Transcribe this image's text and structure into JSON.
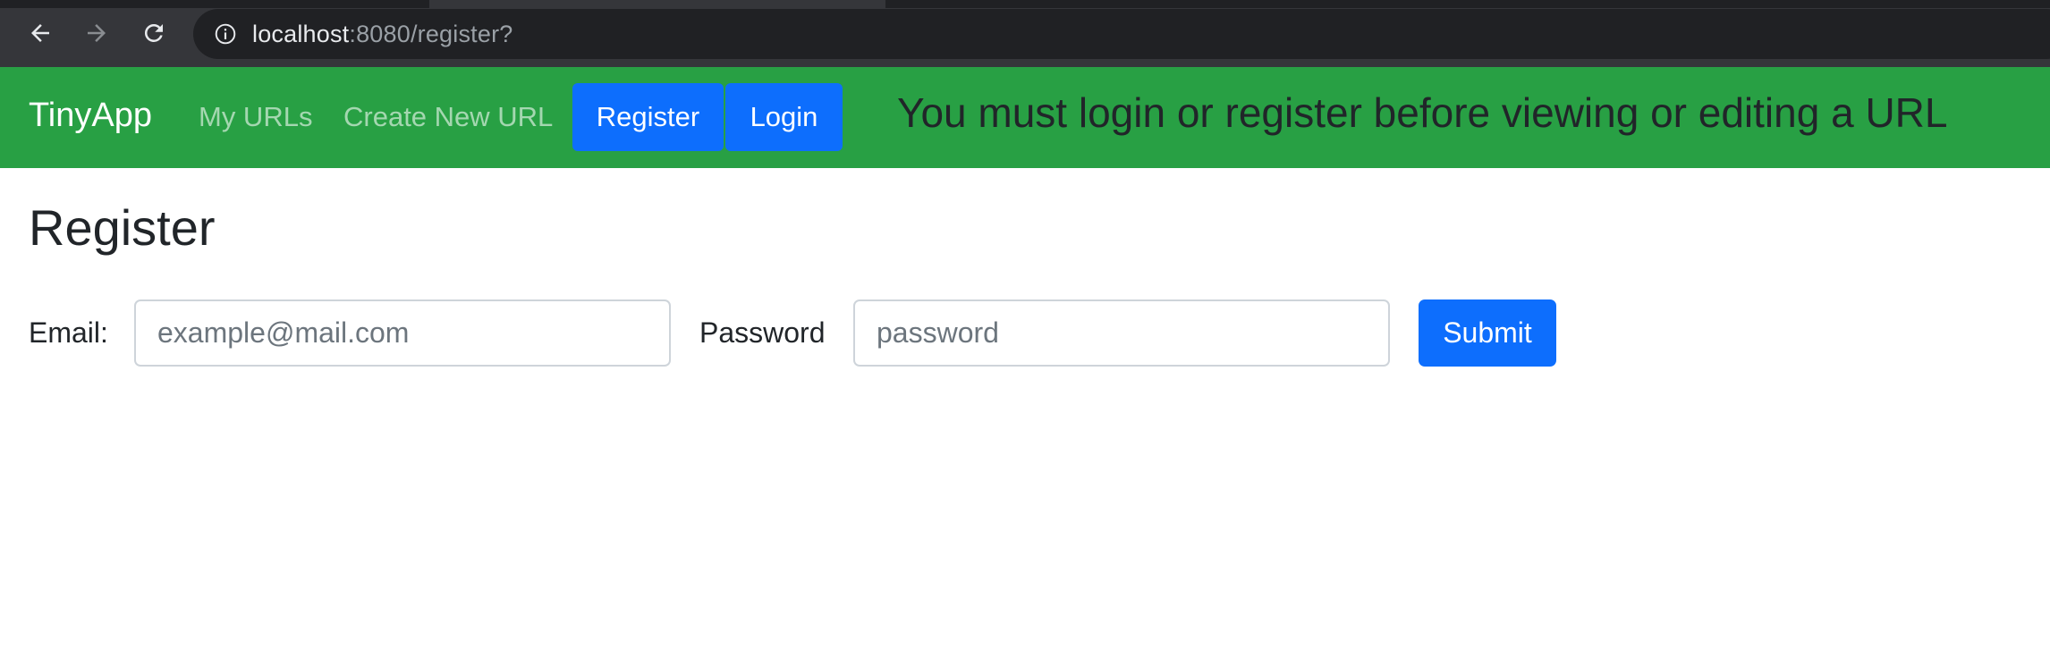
{
  "browser": {
    "url_host": "localhost",
    "url_rest": ":8080/register?",
    "icons": {
      "back": "arrow-left-icon",
      "forward": "arrow-right-icon",
      "reload": "reload-icon",
      "site_info": "info-icon"
    }
  },
  "navbar": {
    "brand": "TinyApp",
    "links": {
      "my_urls": "My URLs",
      "create_new_url": "Create New URL"
    },
    "register_label": "Register",
    "login_label": "Login",
    "message": "You must login or register before viewing or editing a URL",
    "colors": {
      "background": "#28a044",
      "button": "#0d6efd"
    }
  },
  "main": {
    "title": "Register",
    "email_label": "Email:",
    "email_placeholder": "example@mail.com",
    "password_label": "Password",
    "password_placeholder": "password",
    "submit_label": "Submit"
  }
}
